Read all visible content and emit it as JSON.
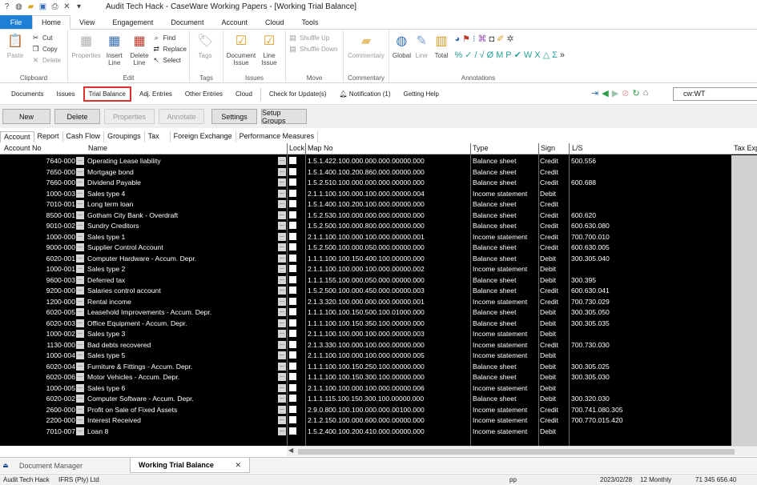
{
  "window": {
    "title": "Audit Tech Hack - CaseWare Working Papers - [Working Trial Balance]",
    "quick_access_icons": [
      "help-icon",
      "globe-icon",
      "open-folder-icon",
      "save-icon",
      "print-icon",
      "close-x-icon",
      "dropdown-icon"
    ]
  },
  "menu": {
    "tabs": [
      "File",
      "Home",
      "View",
      "Engagement",
      "Document",
      "Account",
      "Cloud",
      "Tools"
    ],
    "active": "Home"
  },
  "ribbon": {
    "clipboard": {
      "label": "Clipboard",
      "paste": "Paste",
      "cut": "Cut",
      "copy": "Copy",
      "delete": "Delete"
    },
    "edit": {
      "label": "Edit",
      "properties": "Properties",
      "insert_line": "Insert Line",
      "delete_line": "Delete Line",
      "find": "Find",
      "replace": "Replace",
      "select": "Select"
    },
    "tags": {
      "label": "Tags",
      "tags": "Tags"
    },
    "issues": {
      "label": "Issues",
      "document_issue": "Document Issue",
      "line_issue": "Line Issue"
    },
    "move": {
      "label": "Move",
      "shuffle_up": "Shuffle Up",
      "shuffle_down": "Shuffle Down"
    },
    "commentary": {
      "label": "Commentary",
      "commentary": "Commentary"
    },
    "annotations": {
      "label": "Annotations",
      "global": "Global",
      "line": "Line",
      "total": "Total"
    }
  },
  "nav": {
    "items": [
      "Documents",
      "Issues",
      "Trial Balance",
      "Adj. Entries",
      "Other Entries",
      "Cloud",
      "Check for Update(s)",
      "Notification (1)",
      "Getting Help"
    ],
    "highlighted": "Trial Balance",
    "go_to_value": "cw:WT"
  },
  "actions": {
    "new": "New",
    "delete": "Delete",
    "properties": "Properties",
    "annotate": "Annotate",
    "settings": "Settings",
    "setup_groups": "Setup Groups"
  },
  "view_tabs": [
    "Account",
    "Report",
    "Cash Flow",
    "Groupings",
    "Tax",
    "Foreign Exchange",
    "Performance Measures"
  ],
  "grid": {
    "columns": [
      "Account No",
      "Name",
      "Lock",
      "Map No",
      "Type",
      "Sign",
      "L/S",
      "Tax Exp"
    ],
    "rows": [
      {
        "account": "7640-000",
        "name": "Operating Lease liability",
        "map": "1.5.1.422.100.000.000.000.00000.000",
        "type": "Balance sheet",
        "sign": "Credit",
        "ls": "500.556"
      },
      {
        "account": "7650-000",
        "name": "Mortgage bond",
        "map": "1.5.1.400.100.200.860.000.00000.000",
        "type": "Balance sheet",
        "sign": "Credit",
        "ls": ""
      },
      {
        "account": "7660-000",
        "name": "Dividend Payable",
        "map": "1.5.2.510.100.000.000.000.00000.000",
        "type": "Balance sheet",
        "sign": "Credit",
        "ls": "600.688"
      },
      {
        "account": "1000-003",
        "name": "Sales type 4",
        "map": "2.1.1.100.100.000.100.000.00000.004",
        "type": "Income statement",
        "sign": "Debit",
        "ls": ""
      },
      {
        "account": "7010-001",
        "name": "Long term loan",
        "map": "1.5.1.400.100.200.100.000.00000.000",
        "type": "Balance sheet",
        "sign": "Credit",
        "ls": ""
      },
      {
        "account": "8500-001",
        "name": "Gotham City Bank -  Overdraft",
        "map": "1.5.2.530.100.000.000.000.00000.000",
        "type": "Balance sheet",
        "sign": "Credit",
        "ls": "600.620"
      },
      {
        "account": "9010-002",
        "name": "Sundry Creditors",
        "map": "1.5.2.500.100.000.800.000.00000.000",
        "type": "Balance sheet",
        "sign": "Credit",
        "ls": "600.630.080"
      },
      {
        "account": "1000-000",
        "name": "Sales type 1",
        "map": "2.1.1.100.100.000.100.000.00000.001",
        "type": "Income statement",
        "sign": "Credit",
        "ls": "700.700.010"
      },
      {
        "account": "9000-000",
        "name": "Supplier Control Account",
        "map": "1.5.2.500.100.000.050.000.00000.000",
        "type": "Balance sheet",
        "sign": "Credit",
        "ls": "600.630.005"
      },
      {
        "account": "6020-001",
        "name": "Computer Hardware - Accum. Depr.",
        "map": "1.1.1.100.100.150.400.100.00000.000",
        "type": "Balance sheet",
        "sign": "Debit",
        "ls": "300.305.040"
      },
      {
        "account": "1000-001",
        "name": "Sales type 2",
        "map": "2.1.1.100.100.000.100.000.00000.002",
        "type": "Income statement",
        "sign": "Debit",
        "ls": ""
      },
      {
        "account": "9600-003",
        "name": "Deferred tax",
        "map": "1.1.1.155.100.000.050.000.00000.000",
        "type": "Balance sheet",
        "sign": "Debit",
        "ls": "300.395"
      },
      {
        "account": "9200-000",
        "name": "Salaries control account",
        "map": "1.5.2.500.100.000.450.000.00000.003",
        "type": "Balance sheet",
        "sign": "Credit",
        "ls": "600.630.041"
      },
      {
        "account": "1200-000",
        "name": "Rental income",
        "map": "2.1.3.320.100.000.000.000.00000.001",
        "type": "Income statement",
        "sign": "Credit",
        "ls": "700.730.029"
      },
      {
        "account": "6020-005",
        "name": "Leasehold Improvements - Accum. Depr.",
        "map": "1.1.1.100.100.150.500.100.01000.000",
        "type": "Balance sheet",
        "sign": "Debit",
        "ls": "300.305.050"
      },
      {
        "account": "6020-003",
        "name": "Office Equipment - Accum. Depr.",
        "map": "1.1.1.100.100.150.350.100.00000.000",
        "type": "Balance sheet",
        "sign": "Debit",
        "ls": "300.305.035"
      },
      {
        "account": "1000-002",
        "name": "Sales type 3",
        "map": "2.1.1.100.100.000.100.000.00000.003",
        "type": "Income statement",
        "sign": "Debit",
        "ls": ""
      },
      {
        "account": "1130-000",
        "name": "Bad debts recovered",
        "map": "2.1.3.330.100.000.100.000.00000.000",
        "type": "Income statement",
        "sign": "Credit",
        "ls": "700.730.030"
      },
      {
        "account": "1000-004",
        "name": "Sales type 5",
        "map": "2.1.1.100.100.000.100.000.00000.005",
        "type": "Income statement",
        "sign": "Debit",
        "ls": ""
      },
      {
        "account": "6020-004",
        "name": "Furniture & Fittings - Accum. Depr.",
        "map": "1.1.1.100.100.150.250.100.00000.000",
        "type": "Balance sheet",
        "sign": "Debit",
        "ls": "300.305.025"
      },
      {
        "account": "6020-006",
        "name": "Motor Vehicles - Accum. Depr.",
        "map": "1.1.1.100.100.150.300.100.00000.000",
        "type": "Balance sheet",
        "sign": "Debit",
        "ls": "300.305.030"
      },
      {
        "account": "1000-005",
        "name": "Sales type 6",
        "map": "2.1.1.100.100.000.100.000.00000.006",
        "type": "Income statement",
        "sign": "Debit",
        "ls": ""
      },
      {
        "account": "6020-002",
        "name": "Computer Software - Accum. Depr.",
        "map": "1.1.1.115.100.150.300.100.00000.000",
        "type": "Balance sheet",
        "sign": "Debit",
        "ls": "300.320.030"
      },
      {
        "account": "2600-000",
        "name": "Profit on Sale of Fixed Assets",
        "map": "2.9.0.800.100.100.000.000.00100.000",
        "type": "Income statement",
        "sign": "Credit",
        "ls": "700.741.080.305"
      },
      {
        "account": "2200-000",
        "name": "Interest Received",
        "map": "2.1.2.150.100.000.600.000.00000.000",
        "type": "Income statement",
        "sign": "Credit",
        "ls": "700.770.015.420"
      },
      {
        "account": "7010-007",
        "name": "Loan 8",
        "map": "1.5.2.400.100.200.410.000.00000.000",
        "type": "Income statement",
        "sign": "Debit",
        "ls": ""
      }
    ]
  },
  "doc_tabs": {
    "inactive": "Document Manager",
    "active": "Working Trial Balance",
    "close": "✕"
  },
  "status": {
    "client": "Audit Tech Hack",
    "framework": "IFRS (Pty) Ltd",
    "pp": "pp",
    "date": "2023/02/28",
    "period": "12  Monthly",
    "amount": "71 345 656.40"
  },
  "colors": {
    "file_tab": "#1e7fd6",
    "grid_bg": "#000000",
    "highlight_border": "#e03030"
  }
}
